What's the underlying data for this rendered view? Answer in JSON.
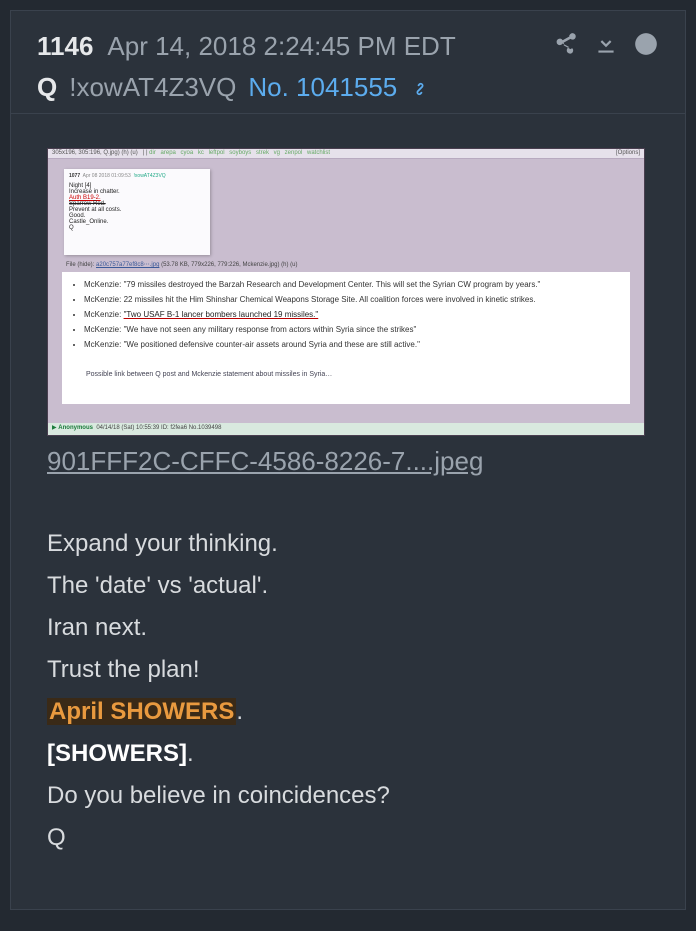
{
  "header": {
    "post_number": "1146",
    "date": "Apr 14, 2018 2:24:45 PM EDT",
    "q_letter": "Q",
    "tripcode": "!xowAT4Z3VQ",
    "post_no": "No. 1041555"
  },
  "image_filename": "901FFF2C-CFFC-4586-8226-7....jpeg",
  "embedded": {
    "topbar_text": "305x196, 305:196, Q.jpg) (h) (u)",
    "breadcrumb": [
      "dir",
      "arepa",
      "cyoa",
      "kc",
      "leftpol",
      "soyboys",
      "strek",
      "vg",
      "zenpol",
      "watchlist"
    ],
    "options": "[Options]",
    "inner_post": {
      "num": "1077",
      "meta": "Apr 08 2018 01:09:53",
      "trip": "!xowAT4Z3VQ",
      "lines": [
        "Night [4]",
        "Increase in chatter.",
        "Auth B19-2.",
        "Sparrow Red.",
        "Prevent at all costs.",
        "Good.",
        "Castle_Online.",
        "Q"
      ]
    },
    "file_line_prefix": "File (hide): ",
    "file_link": "a20c757a77ef8c8⋯.jpg",
    "file_meta": "(53.78 KB, 779x226, 779:226, Mckenzie.jpg) (h) (u)",
    "bullets": [
      "McKenzie: \"79 missiles destroyed the Barzah Research and Development Center. This will set the Syrian CW program by years.\"",
      "McKenzie: 22 missiles hit the Him Shinshar Chemical Weapons Storage Site. All coalition forces were involved in kinetic strikes.",
      {
        "prefix": "McKenzie: ",
        "underlined": "\"Two USAF B-1 lancer bombers launched 19 missiles.\""
      },
      "McKenzie: \"We have not seen any military response from actors within Syria since the strikes\"",
      "McKenzie: \"We positioned defensive counter-air assets around Syria and these are still active.\""
    ],
    "summary": "Possible link between Q post and Mckenzie statement about missiles in Syria…",
    "footer": "Anonymous  04/14/18 (Sat) 10:55:39 ID: f2fea6 No.1039498"
  },
  "message": {
    "l1": "Expand your thinking.",
    "l2": "The 'date' vs 'actual'.",
    "l3": "Iran next.",
    "l4": "Trust the plan!",
    "l5_hl": "April SHOWERS",
    "l5_dot": ".",
    "l6": "[SHOWERS]",
    "l6_dot": ".",
    "l7": "Do you believe in coincidences?",
    "l8": "Q"
  }
}
